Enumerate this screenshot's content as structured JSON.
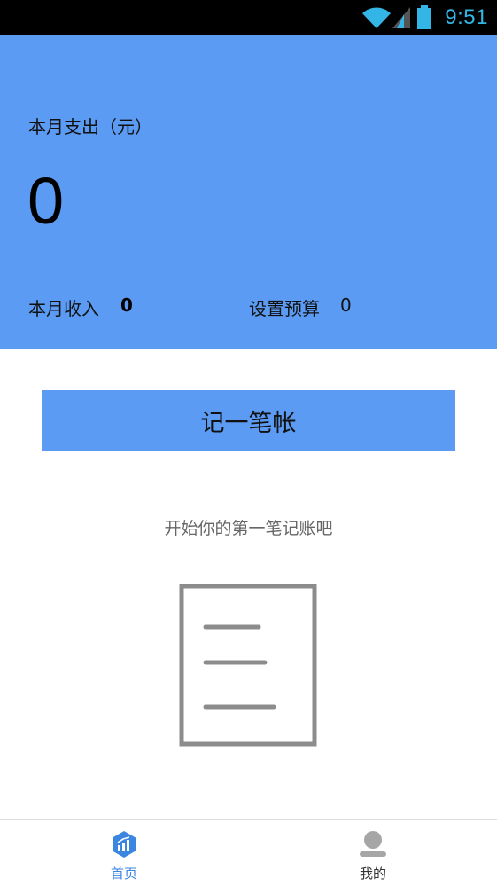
{
  "status_bar": {
    "time": "9:51",
    "icons": [
      "wifi-icon",
      "signal-icon",
      "battery-icon"
    ],
    "time_color": "#33b5e5"
  },
  "summary": {
    "month_expense_label": "本月支出（元）",
    "month_expense_value": "0",
    "income_label": "本月收入",
    "income_value": "0",
    "budget_label": "设置预算",
    "budget_value": "0"
  },
  "actions": {
    "record_button_label": "记一笔帐"
  },
  "empty_state": {
    "hint": "开始你的第一笔记账吧",
    "icon": "document-icon"
  },
  "bottom_nav": {
    "items": [
      {
        "label": "首页",
        "icon": "home-chart-icon",
        "active": true
      },
      {
        "label": "我的",
        "icon": "person-icon",
        "active": false
      }
    ]
  },
  "colors": {
    "accent": "#5b9bf3",
    "nav_active": "#3a86e0",
    "nav_inactive": "#999999"
  }
}
